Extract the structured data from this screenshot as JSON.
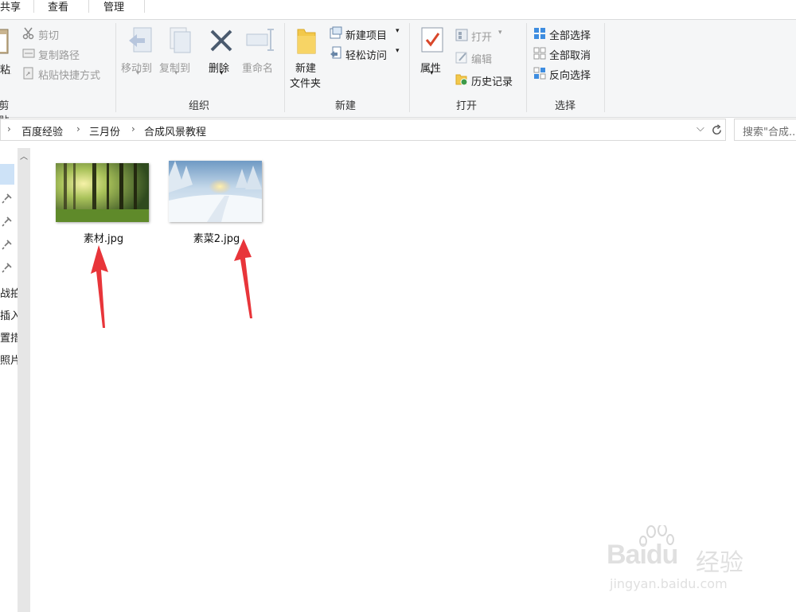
{
  "tabs": [
    "共享",
    "查看",
    "管理"
  ],
  "ribbon": {
    "clipboard": {
      "paste_label": "粘贴",
      "cut": "剪切",
      "copy_path": "复制路径",
      "paste_shortcut": "粘贴快捷方式",
      "group": "剪贴板"
    },
    "organize": {
      "move_to": "移动到",
      "copy_to": "复制到",
      "delete": "删除",
      "rename": "重命名",
      "group": "组织"
    },
    "new": {
      "new_folder_line1": "新建",
      "new_folder_line2": "文件夹",
      "new_item": "新建项目",
      "easy_access": "轻松访问",
      "group": "新建"
    },
    "open": {
      "properties": "属性",
      "open": "打开",
      "edit": "编辑",
      "history": "历史记录",
      "group": "打开"
    },
    "select": {
      "select_all": "全部选择",
      "select_none": "全部取消",
      "invert": "反向选择",
      "group": "选择"
    }
  },
  "address": {
    "crumbs": [
      "百度经验",
      "三月份",
      "合成风景教程"
    ],
    "search_placeholder": "搜索\"合成..."
  },
  "nav": {
    "items": [
      "战拍",
      "插入",
      "置措",
      "照片"
    ]
  },
  "files": [
    {
      "name": "素材.jpg",
      "thumb": "forest"
    },
    {
      "name": "素菜2.jpg",
      "thumb": "snow"
    }
  ],
  "colors": {
    "arrow": "#e8353a",
    "ribbon_bg": "#f5f6f7"
  },
  "watermark": {
    "brand": "Baidu",
    "cn": "经验",
    "url": "jingyan.baidu.com"
  }
}
